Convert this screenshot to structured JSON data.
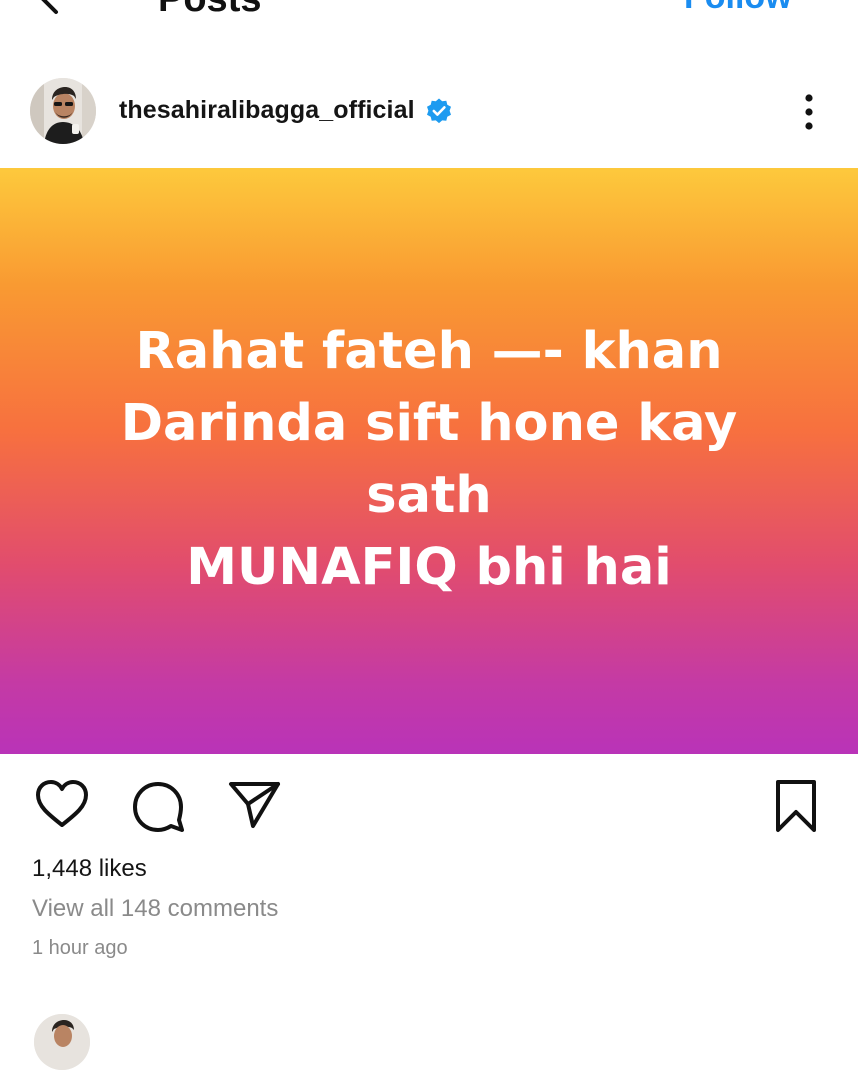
{
  "header": {
    "title": "Posts",
    "follow_label": "Follow"
  },
  "post": {
    "username": "thesahiralibagga_official",
    "verified": true,
    "image_text_lines": [
      "Rahat fateh —- khan",
      "Darinda sift hone kay",
      "sath",
      "MUNAFIQ  bhi hai"
    ],
    "likes": "1,448 likes",
    "view_comments": "View all 148 comments",
    "timestamp": "1 hour ago"
  },
  "colors": {
    "follow_blue": "#1a8cf0",
    "verified_blue": "#1d9bf0",
    "muted_text": "#8a8a8a",
    "gradient_top": "#fdc93c",
    "gradient_mid": "#f7703f",
    "gradient_bottom": "#b933b8"
  },
  "icons": {
    "back": "back-arrow-icon",
    "more": "more-vertical-icon",
    "verified": "verified-badge-icon",
    "like": "heart-icon",
    "comment": "comment-icon",
    "share": "send-icon",
    "save": "bookmark-icon"
  }
}
